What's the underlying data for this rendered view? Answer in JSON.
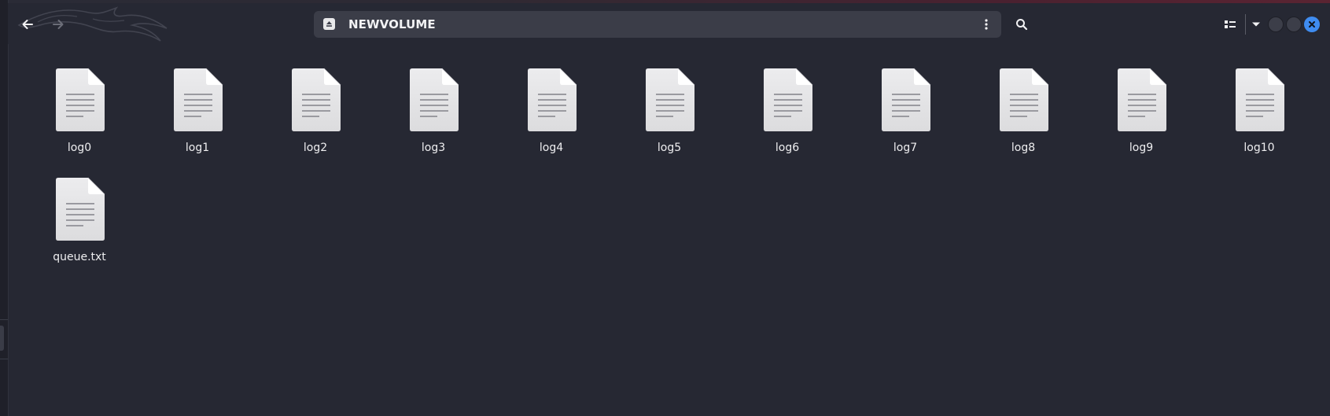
{
  "header": {
    "back_icon": "arrow-left-icon",
    "forward_icon": "arrow-right-icon",
    "location": {
      "icon": "drive-eject-icon",
      "label": "NEWVOLUME",
      "menu_icon": "vertical-dots-icon"
    },
    "search_icon": "search-icon",
    "view_icon": "view-list-icon",
    "view_menu_icon": "chevron-down-icon",
    "window_controls": {
      "minimize_icon": "minimize-icon",
      "maximize_icon": "maximize-icon",
      "close_icon": "close-icon"
    }
  },
  "files": [
    {
      "name": "log0",
      "icon": "text-file-icon"
    },
    {
      "name": "log1",
      "icon": "text-file-icon"
    },
    {
      "name": "log2",
      "icon": "text-file-icon"
    },
    {
      "name": "log3",
      "icon": "text-file-icon"
    },
    {
      "name": "log4",
      "icon": "text-file-icon"
    },
    {
      "name": "log5",
      "icon": "text-file-icon"
    },
    {
      "name": "log6",
      "icon": "text-file-icon"
    },
    {
      "name": "log7",
      "icon": "text-file-icon"
    },
    {
      "name": "log8",
      "icon": "text-file-icon"
    },
    {
      "name": "log9",
      "icon": "text-file-icon"
    },
    {
      "name": "log10",
      "icon": "text-file-icon"
    },
    {
      "name": "queue.txt",
      "icon": "text-file-icon"
    }
  ],
  "colors": {
    "background": "#262833",
    "pathbar": "#3b3d48",
    "close_button": "#3f8cf0",
    "text": "#eeeef0"
  }
}
